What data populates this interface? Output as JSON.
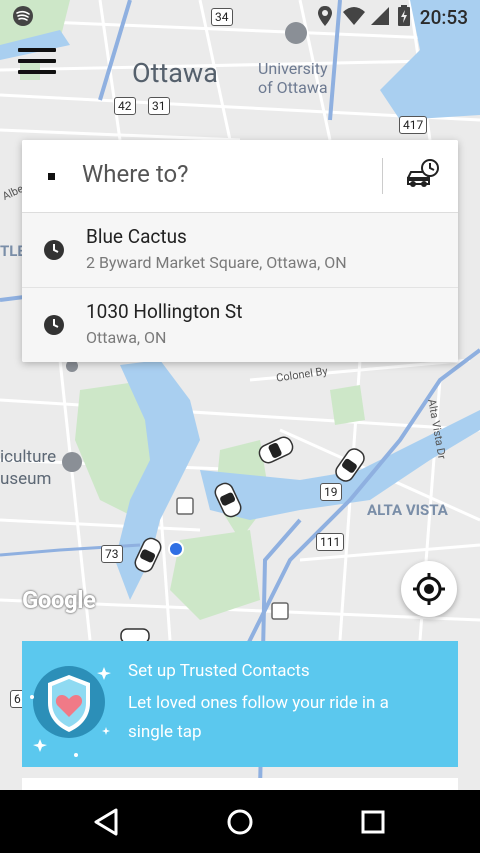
{
  "status_bar": {
    "time": "20:53"
  },
  "map": {
    "labels": {
      "city": "Ottawa",
      "university": "University\nof Ottawa",
      "museum": "iculture\nuseum",
      "alta_vista": "ALTA VISTA",
      "colonel_by": "Colonel By",
      "alta_vista_dr": "Alta Vista Dr",
      "tle": "TLE",
      "albe": "Albe"
    },
    "shields": {
      "r34": "34",
      "r42": "42",
      "r31": "31",
      "r417": "417",
      "r19": "19",
      "r111": "111",
      "r73": "73",
      "r6": "6"
    },
    "google": "Google"
  },
  "search": {
    "placeholder": "Where to?",
    "recent": [
      {
        "title": "Blue Cactus",
        "subtitle": "2 Byward Market Square, Ottawa, ON"
      },
      {
        "title": "1030 Hollington St",
        "subtitle": "Ottawa, ON"
      }
    ]
  },
  "promo": {
    "heading": "Set up Trusted Contacts",
    "body": "Let loved ones follow your ride in a single tap"
  },
  "colors": {
    "accent": "#5bc8ee",
    "route": "#8fb0e0"
  }
}
